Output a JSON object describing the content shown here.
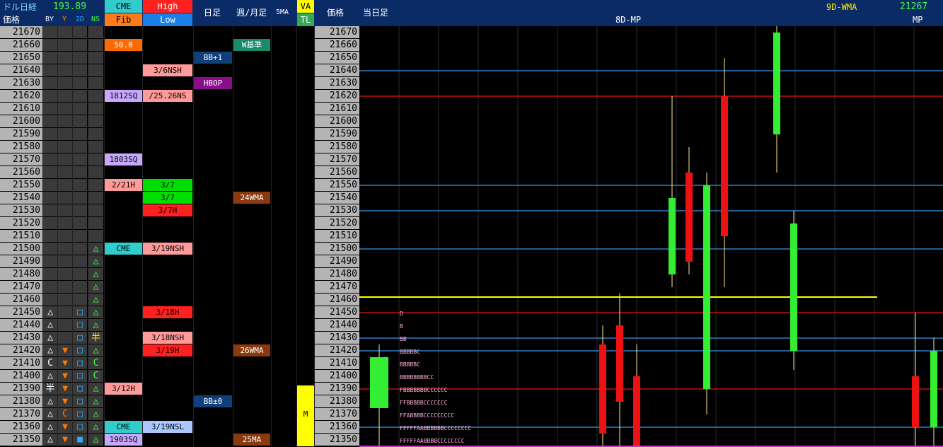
{
  "header": {
    "title": "ドル日経",
    "usdjpy": "193.89",
    "cme": "CME",
    "high": "High",
    "fib": "Fib",
    "low": "Low",
    "daily": "日足",
    "weekly_monthly": "週/月足",
    "ma5": "5MA",
    "va": "VA",
    "tl": "TL",
    "price": "価格",
    "price_right": "価格",
    "by": "BY",
    "y": "Y",
    "d2": "2D",
    "ns": "NS",
    "today": "当日足",
    "mp8d": "8D-MP",
    "wma9d": "9D-WMA",
    "mp_value": "21267",
    "mp": "MP"
  },
  "colors": {
    "header_bg": "#0b2b66",
    "price_col": "#b4b4b4",
    "green_candle": "#33ee33",
    "red_candle": "#ee1111",
    "blue_line": "#2a7fc9",
    "red_line": "#c01010",
    "yellow_line": "#ffff00"
  },
  "prices": [
    21670,
    21660,
    21650,
    21640,
    21630,
    21620,
    21610,
    21600,
    21590,
    21580,
    21570,
    21560,
    21550,
    21540,
    21530,
    21520,
    21510,
    21500,
    21490,
    21480,
    21470,
    21460,
    21450,
    21440,
    21430,
    21420,
    21410,
    21400,
    21390,
    21380,
    21370,
    21360,
    21350
  ],
  "levels": {
    "cme": {
      "21660": "50.0",
      "21620": "1812SQ",
      "21570": "1803SQ",
      "21550": "2/21H",
      "21500": "CME",
      "21390": "3/12H",
      "21360": "CME",
      "21350": "1903SQ"
    },
    "high_low": {
      "21640": "3/6NSH",
      "21620": "/25.26NS",
      "21550": "3/7",
      "21540": "3/7",
      "21530": "3/7H",
      "21500": "3/19NSH",
      "21450": "3/18H",
      "21430": "3/18NSH",
      "21420": "3/19H",
      "21360": "3/19NSL"
    },
    "daily": {
      "21650": "BB+1",
      "21630": "HBOP",
      "21380": "BB±0"
    },
    "weekly": {
      "21660": "W基準",
      "21540": "24WMA",
      "21420": "26WMA",
      "21350": "25MA"
    },
    "va": {
      "21370": "M"
    },
    "by": {
      "21450": "△",
      "21440": "△",
      "21430": "△",
      "21420": "△",
      "21410": "C",
      "21400": "△",
      "21390": "半",
      "21380": "△",
      "21370": "△",
      "21360": "△",
      "21350": "△"
    },
    "y": {
      "21420": "▼",
      "21410": "▼",
      "21400": "▼",
      "21390": "▼",
      "21380": "▼",
      "21370": "C",
      "21360": "▼",
      "21350": "▼"
    },
    "d2": {
      "21450": "□",
      "21440": "□",
      "21430": "□",
      "21420": "□",
      "21410": "□",
      "21400": "□",
      "21390": "□",
      "21380": "□",
      "21370": "□",
      "21360": "□",
      "21350": "■"
    },
    "ns": {
      "21500": "△",
      "21490": "△",
      "21480": "△",
      "21470": "△",
      "21460": "△",
      "21450": "△",
      "21440": "△",
      "21430": "半",
      "21420": "△",
      "21410": "C",
      "21400": "C",
      "21390": "△",
      "21380": "△",
      "21370": "△",
      "21360": "△",
      "21350": "△"
    }
  },
  "tpo": {
    "21450": "D",
    "21440": "B",
    "21430": "BB",
    "21420": "BBBBBC",
    "21410": "BBBBBC",
    "21400": "BBBBBBBBCC",
    "21390": "FBBBBBBBCCCCCC",
    "21380": "FFBBBBBCCCCCCC",
    "21370": "FFABBBBCCCCCCCCC",
    "21360": "FFFFFAABBBBBBCCCCCCCC",
    "21350": "FFFFFAABBBBCCCCCCCC"
  },
  "chart_data": {
    "type": "candlestick",
    "y_axis": {
      "min": 21350,
      "max": 21670,
      "step": 10
    },
    "horizontal_lines": [
      {
        "price": 21640,
        "color": "blue"
      },
      {
        "price": 21620,
        "color": "red"
      },
      {
        "price": 21550,
        "color": "blue"
      },
      {
        "price": 21530,
        "color": "blue"
      },
      {
        "price": 21500,
        "color": "blue"
      },
      {
        "price": 21460,
        "color": "yellow"
      },
      {
        "price": 21450,
        "color": "red"
      },
      {
        "price": 21430,
        "color": "blue"
      },
      {
        "price": 21420,
        "color": "blue"
      },
      {
        "price": 21390,
        "color": "red"
      },
      {
        "price": 21360,
        "color": "blue"
      }
    ],
    "candles": [
      {
        "open": 21375,
        "close": 21415,
        "high": 21425,
        "low": 21340,
        "dir": "up"
      },
      {
        "open": 21425,
        "close": 21355,
        "high": 21440,
        "low": 21320,
        "dir": "down"
      },
      {
        "open": 21440,
        "close": 21380,
        "high": 21465,
        "low": 21340,
        "dir": "down"
      },
      {
        "open": 21400,
        "close": 21330,
        "high": 21425,
        "low": 21300,
        "dir": "down"
      },
      {
        "open": 21480,
        "close": 21540,
        "high": 21620,
        "low": 21470,
        "dir": "up"
      },
      {
        "open": 21560,
        "close": 21490,
        "high": 21580,
        "low": 21480,
        "dir": "down"
      },
      {
        "open": 21390,
        "close": 21550,
        "high": 21560,
        "low": 21370,
        "dir": "up"
      },
      {
        "open": 21620,
        "close": 21510,
        "high": 21650,
        "low": 21470,
        "dir": "down"
      },
      {
        "open": 21590,
        "close": 21670,
        "high": 21690,
        "low": 21560,
        "dir": "up"
      },
      {
        "open": 21420,
        "close": 21520,
        "high": 21530,
        "low": 21405,
        "dir": "up"
      },
      {
        "open": 21400,
        "close": 21360,
        "high": 21450,
        "low": 21340,
        "dir": "down"
      },
      {
        "open": 21360,
        "close": 21420,
        "high": 21430,
        "low": 21340,
        "dir": "up"
      }
    ]
  }
}
